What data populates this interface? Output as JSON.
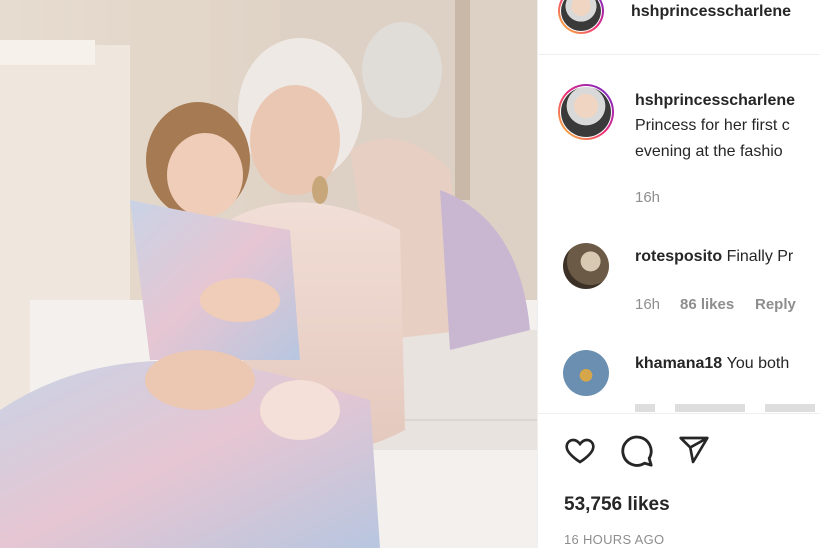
{
  "post": {
    "username": "hshprincesscharlene",
    "caption_line1": "Princess for her first c",
    "caption_line2": "evening at the fashio",
    "caption_time": "16h"
  },
  "comments": [
    {
      "username": "rotesposito",
      "text": "Finally Pr",
      "time": "16h",
      "likes": "86 likes",
      "reply": "Reply"
    },
    {
      "username": "khamana18",
      "text": "You both"
    }
  ],
  "actions": {
    "like": "heart-icon",
    "comment": "comment-icon",
    "share": "share-icon"
  },
  "stats": {
    "likes": "53,756 likes",
    "timestamp": "16 HOURS AGO"
  },
  "colors": {
    "accent": "#ee2a7b",
    "muted": "#8e8e8e",
    "text": "#262626"
  }
}
